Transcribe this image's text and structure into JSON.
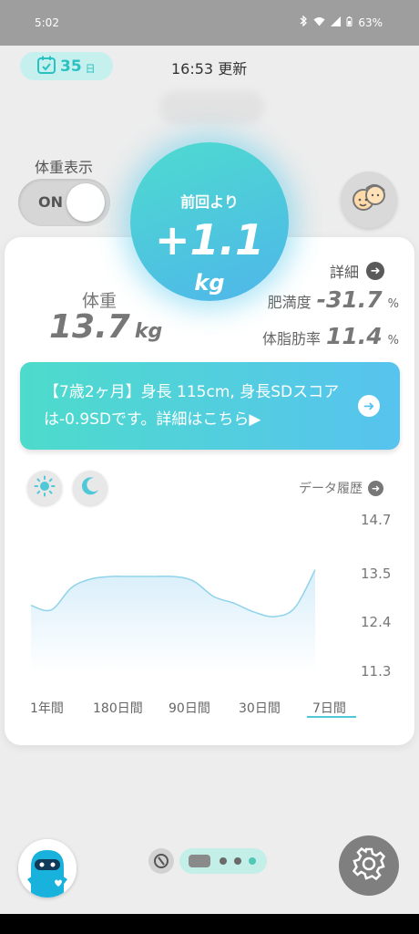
{
  "status_bar": {
    "time": "5:02",
    "battery": "63%"
  },
  "header": {
    "streak_count": "35",
    "streak_unit": "日",
    "updated_text": "16:53 更新"
  },
  "weight_display": {
    "label": "体重表示",
    "toggle_state": "ON"
  },
  "change_bubble": {
    "label": "前回より",
    "value": "+1.1",
    "unit": "kg"
  },
  "summary": {
    "weight_label": "体重",
    "weight_value": "13.7",
    "weight_unit": "kg",
    "detail_link": "詳細",
    "obesity_label": "肥満度",
    "obesity_value": "-31.7",
    "obesity_unit": "%",
    "bodyfat_label": "体脂肪率",
    "bodyfat_value": "11.4",
    "bodyfat_unit": "%"
  },
  "banner": {
    "message": "【7歳2ヶ月】身長 115cm, 身長SDスコアは-0.9SDです。詳細はこちら▶"
  },
  "chart": {
    "history_link": "データ履歴",
    "periods": [
      "1年間",
      "180日間",
      "90日間",
      "30日間",
      "7日間"
    ],
    "selected_period": "7日間"
  },
  "chart_data": {
    "type": "area",
    "title": "",
    "xlabel": "",
    "ylabel": "",
    "ylim": [
      11.3,
      14.7
    ],
    "y_ticks": [
      14.7,
      13.5,
      12.4,
      11.3
    ],
    "grid": false,
    "series": [
      {
        "values": [
          12.8,
          12.7,
          13.2,
          13.4,
          13.45,
          13.45,
          13.45,
          13.45,
          13.35,
          13.0,
          12.85,
          12.65,
          12.55,
          12.75,
          13.6
        ]
      }
    ],
    "colors": {
      "line": "#8fd3ea",
      "fill_top": "#d8eefa",
      "fill_bottom": "#ffffff"
    }
  },
  "colors": {
    "accent": "#4fc8d8",
    "bubble_start": "#4ddbcf",
    "bubble_end": "#4fb6ea"
  }
}
